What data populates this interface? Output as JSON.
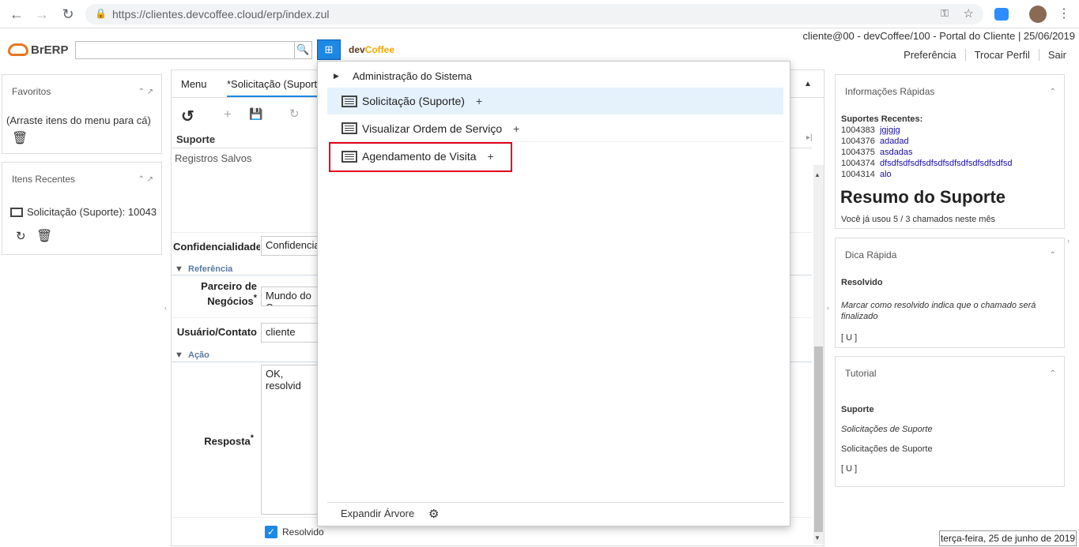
{
  "browser": {
    "url": "https://clientes.devcoffee.cloud/erp/index.zul"
  },
  "header": {
    "logo_text": "BrERP",
    "devcoffee_a": "dev",
    "devcoffee_b": "Coffee",
    "user_info": "cliente@00 - devCoffee/100 - Portal do Cliente | 25/06/2019",
    "links": [
      "Preferência",
      "Trocar Perfil",
      "Sair"
    ]
  },
  "left": {
    "favorites": {
      "title": "Favoritos",
      "hint": "(Arraste itens do menu para cá)"
    },
    "recent": {
      "title": "Itens Recentes",
      "item": "Solicitação (Suporte): 10043"
    }
  },
  "center": {
    "tabs": [
      "Menu",
      "*Solicitação (Suporte"
    ],
    "title": "Suporte",
    "saved": "Registros Salvos",
    "conf_label": "Confidencialidade",
    "conf_value": "Confidencia",
    "sect_ref": "Referência",
    "partner_label_1": "Parceiro de",
    "partner_label_2": "Negócios",
    "partner_value": "Mundo do C",
    "user_label": "Usuário/Contato",
    "user_value": "cliente",
    "sect_action": "Ação",
    "response_label": "Resposta",
    "response_value": "OK, resolvid",
    "resolved": "Resolvido"
  },
  "menu": {
    "root": "Administração do Sistema",
    "items": [
      "Solicitação (Suporte)",
      "Visualizar Ordem de Serviço",
      "Agendamento de Visita"
    ],
    "expand": "Expandir Árvore"
  },
  "right": {
    "info": {
      "title": "Informações Rápidas",
      "subtitle": "Suportes Recentes:",
      "rows": [
        [
          "1004383",
          "jgjgjg"
        ],
        [
          "1004376",
          "adadad"
        ],
        [
          "1004375",
          "asdadas"
        ],
        [
          "1004374",
          "dfsdfsdfsdfsdfsdfsdfsdfsdfsdfsdfsd"
        ],
        [
          "1004314",
          "alo"
        ]
      ],
      "summary": "Resumo do Suporte",
      "usage": "Você já usou 5 / 3 chamados neste mês"
    },
    "tip": {
      "title": "Dica Rápida",
      "head": "Resolvido",
      "body": "Marcar como resolvido indica que o chamado será finalizado",
      "code": "[ U ]"
    },
    "tutorial": {
      "title": "Tutorial",
      "head": "Suporte",
      "italic": "Solicitações de Suporte",
      "plain": "Solicitações de Suporte",
      "code": "[ U ]"
    }
  },
  "status": "terça-feira, 25 de junho de 2019",
  "colors": {
    "accent": "#1e88e5",
    "highlight": "#e5f1fb",
    "red_box": "#e0001a",
    "link": "#1a0dab"
  }
}
